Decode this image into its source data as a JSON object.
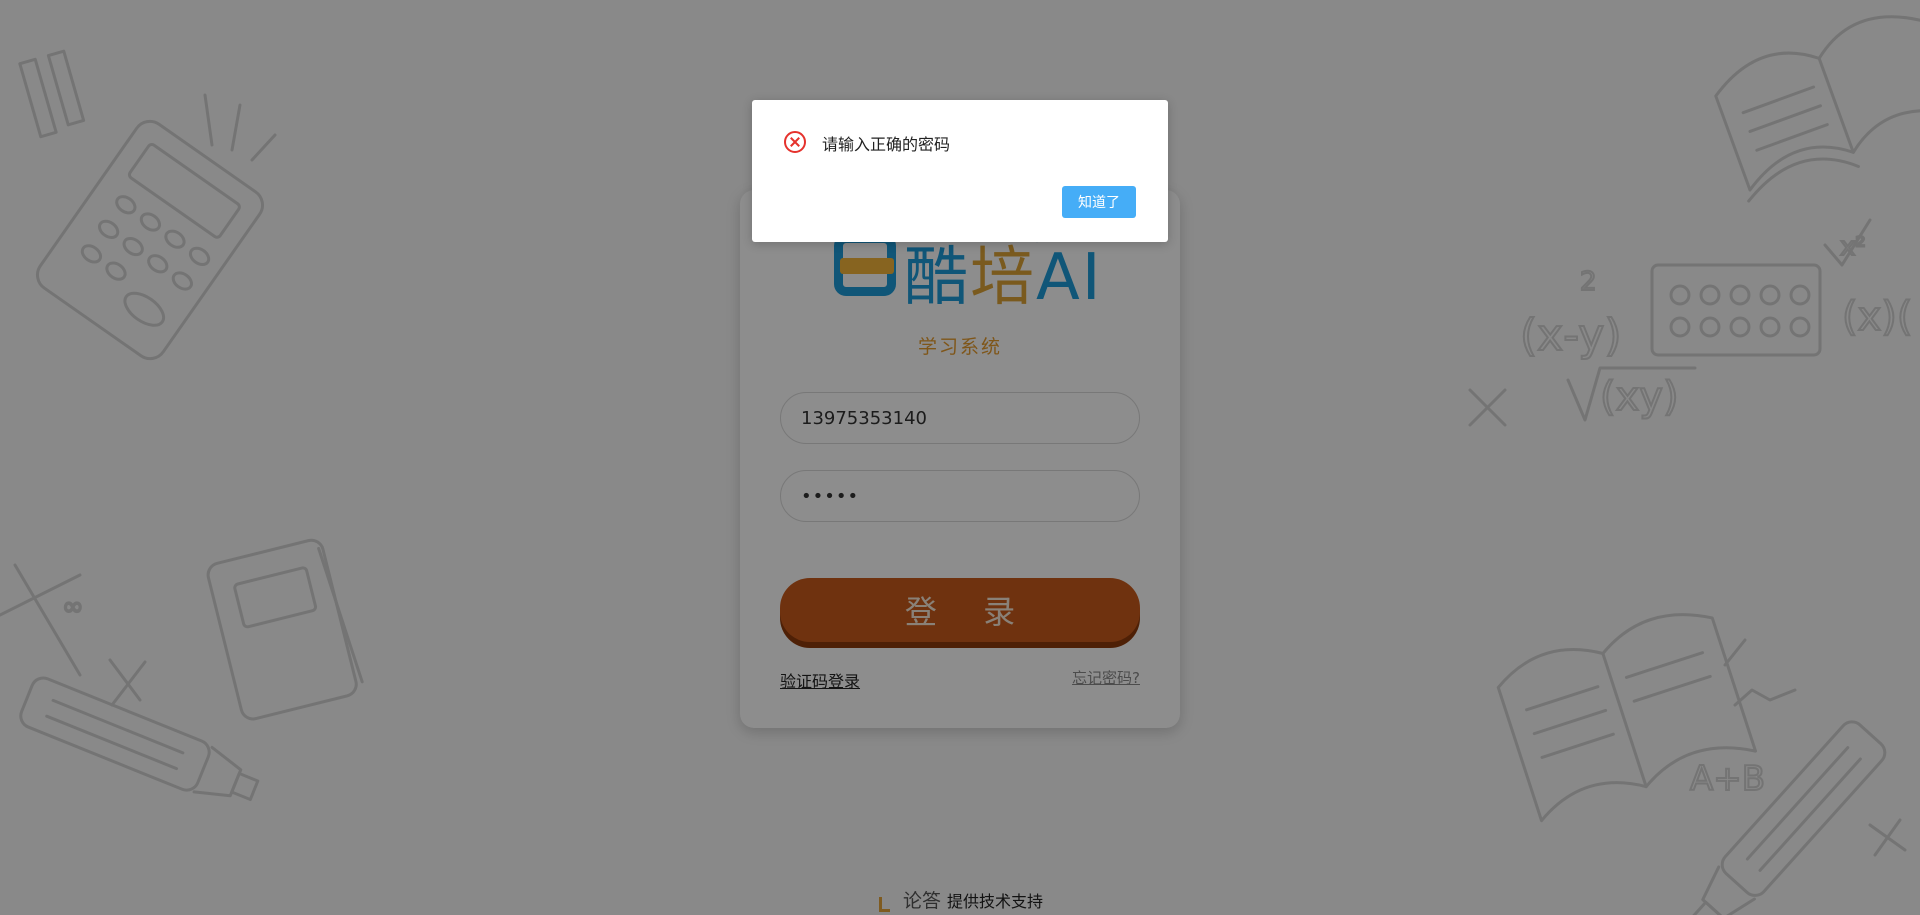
{
  "brand": {
    "logo_text_part1": "酷",
    "logo_text_part2": "培",
    "logo_text_part3": "AI",
    "registered_mark": "®",
    "subtitle": "学习系统"
  },
  "login_form": {
    "phone_value": "13975353140",
    "password_value": "•••••",
    "login_button_label": "登 录",
    "sms_login_link": "验证码登录",
    "forgot_password_link": "忘记密码?"
  },
  "footer": {
    "brand": "论答",
    "text": "提供技术支持"
  },
  "modal": {
    "message": "请输入正确的密码",
    "ok_button_label": "知道了"
  },
  "colors": {
    "brand_blue": "#1d9ad6",
    "brand_gold": "#d9a036",
    "subtitle_orange": "#e39a2e",
    "login_button": "#c75a1c",
    "modal_button": "#45adf7",
    "error_red": "#e5322d"
  }
}
